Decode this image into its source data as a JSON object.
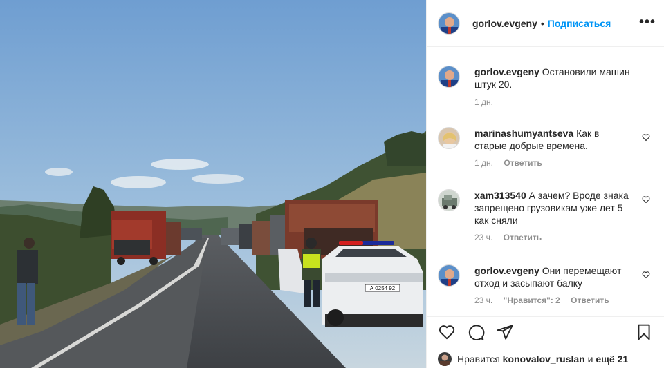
{
  "header": {
    "username": "gorlov.evgeny",
    "separator": "•",
    "follow_label": "Подписаться",
    "more_icon": "more-horizontal-icon"
  },
  "comments": [
    {
      "username": "gorlov.evgeny",
      "text": "Остановили машин штук 20.",
      "time": "1 дн.",
      "reply": "",
      "likes": ""
    },
    {
      "username": "marinashumyantseva",
      "text": "Как в старые добрые времена.",
      "time": "1 дн.",
      "reply": "Ответить",
      "likes": ""
    },
    {
      "username": "xam313540",
      "text": "А зачем? Вроде знака запрещено грузовикам уже лет 5 как сняли",
      "time": "23 ч.",
      "reply": "Ответить",
      "likes": ""
    },
    {
      "username": "gorlov.evgeny",
      "text": "Они перемещают отход и засыпают балку",
      "time": "23 ч.",
      "reply": "Ответить",
      "likes": "\"Нравится\": 2"
    }
  ],
  "footer": {
    "likes_prefix": "Нравится",
    "likes_user": "konovalov_ruslan",
    "likes_and": "и",
    "likes_more": "ещё 21"
  },
  "photo": {
    "plate": "А 0254 92"
  },
  "colors": {
    "accent": "#0095f6",
    "muted": "#8e8e8e",
    "text": "#262626",
    "border": "#efefef"
  }
}
